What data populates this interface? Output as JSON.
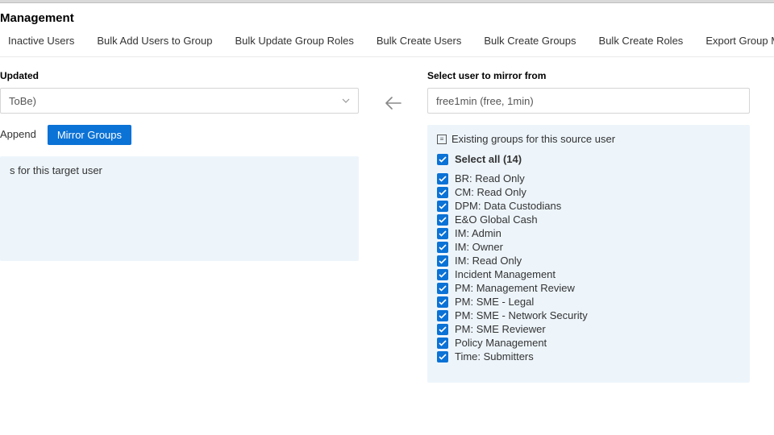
{
  "title": "Management",
  "tabs": [
    "Inactive Users",
    "Bulk Add Users to Group",
    "Bulk Update Group Roles",
    "Bulk Create Users",
    "Bulk Create Groups",
    "Bulk Create Roles",
    "Export Group Members"
  ],
  "left": {
    "label": "Updated",
    "selectValue": "ToBe)",
    "appendLabel": "Append",
    "mirrorBtn": "Mirror Groups",
    "panelHeader": "s for this target user"
  },
  "right": {
    "label": "Select user to mirror from",
    "inputValue": "free1min (free, 1min)",
    "panelHeader": "Existing groups for this source user",
    "selectAll": "Select all (14)",
    "groups": [
      "BR: Read Only",
      "CM: Read Only",
      "DPM: Data Custodians",
      "E&O Global Cash",
      "IM: Admin",
      "IM: Owner",
      "IM: Read Only",
      "Incident Management",
      "PM: Management Review",
      "PM: SME - Legal",
      "PM: SME - Network Security",
      "PM: SME Reviewer",
      "Policy Management",
      "Time: Submitters"
    ]
  }
}
